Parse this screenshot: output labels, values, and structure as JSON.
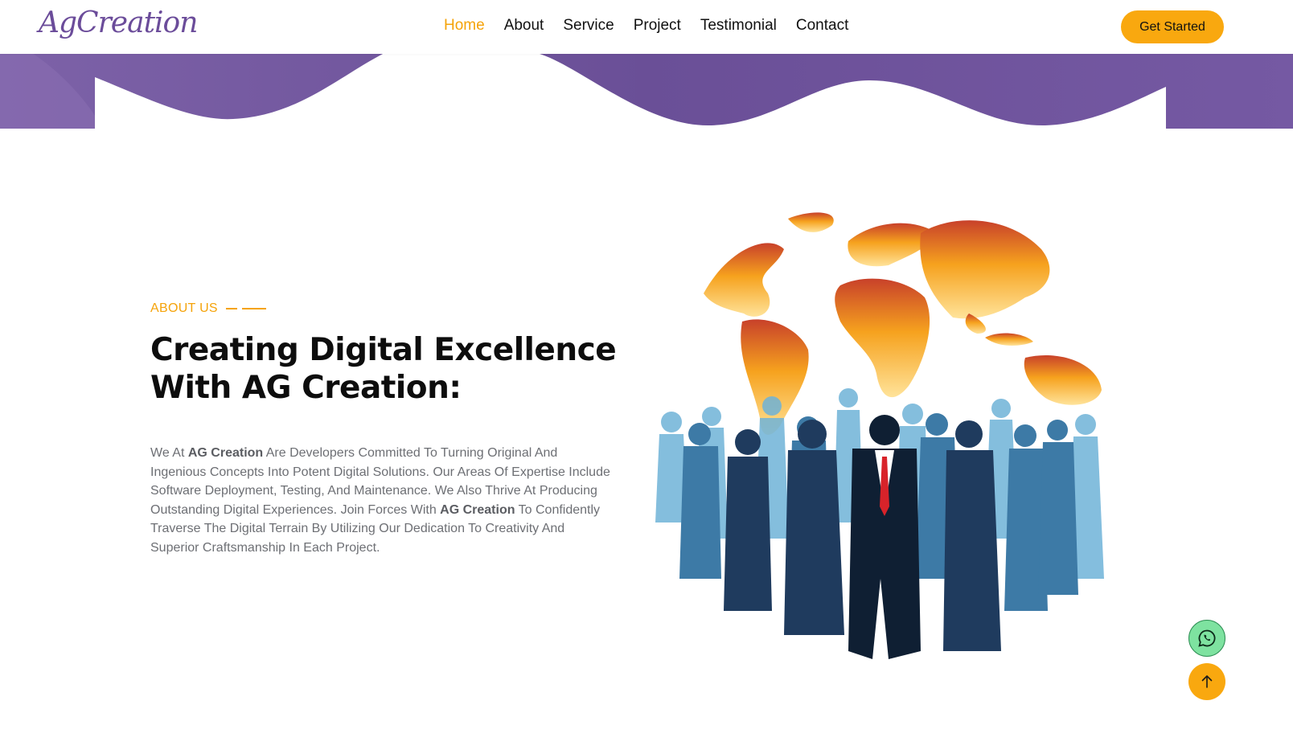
{
  "header": {
    "logo": "AgCreation",
    "nav": [
      "Home",
      "About",
      "Service",
      "Project",
      "Testimonial",
      "Contact"
    ],
    "active_nav": "Home",
    "cta_label": "Get Started"
  },
  "about": {
    "kicker": "ABOUT US",
    "heading_line1": "Creating Digital Excellence",
    "heading_line2": "With AG Creation:",
    "para": {
      "t1": "We At ",
      "b1": "AG Creation",
      "t2": " Are Developers Committed To Turning Original And Ingenious Concepts Into Potent Digital Solutions. Our Areas Of Expertise Include Software Deployment, Testing, And Maintenance. We Also Thrive At Producing Outstanding Digital Experiences. Join Forces With ",
      "b2": "AG Creation",
      "t3": " To Confidently Traverse The Digital Terrain By Utilizing Our Dedication To Creativity And Superior Craftsmanship In Each Project."
    }
  },
  "icons": {
    "whatsapp": "whatsapp-icon",
    "scroll_top": "arrow-up-icon",
    "illustration": "globe-people-illustration"
  },
  "colors": {
    "brand_purple": "#6b4c9a",
    "accent_orange": "#f9a80f",
    "whatsapp_green": "#7ee2a0"
  }
}
